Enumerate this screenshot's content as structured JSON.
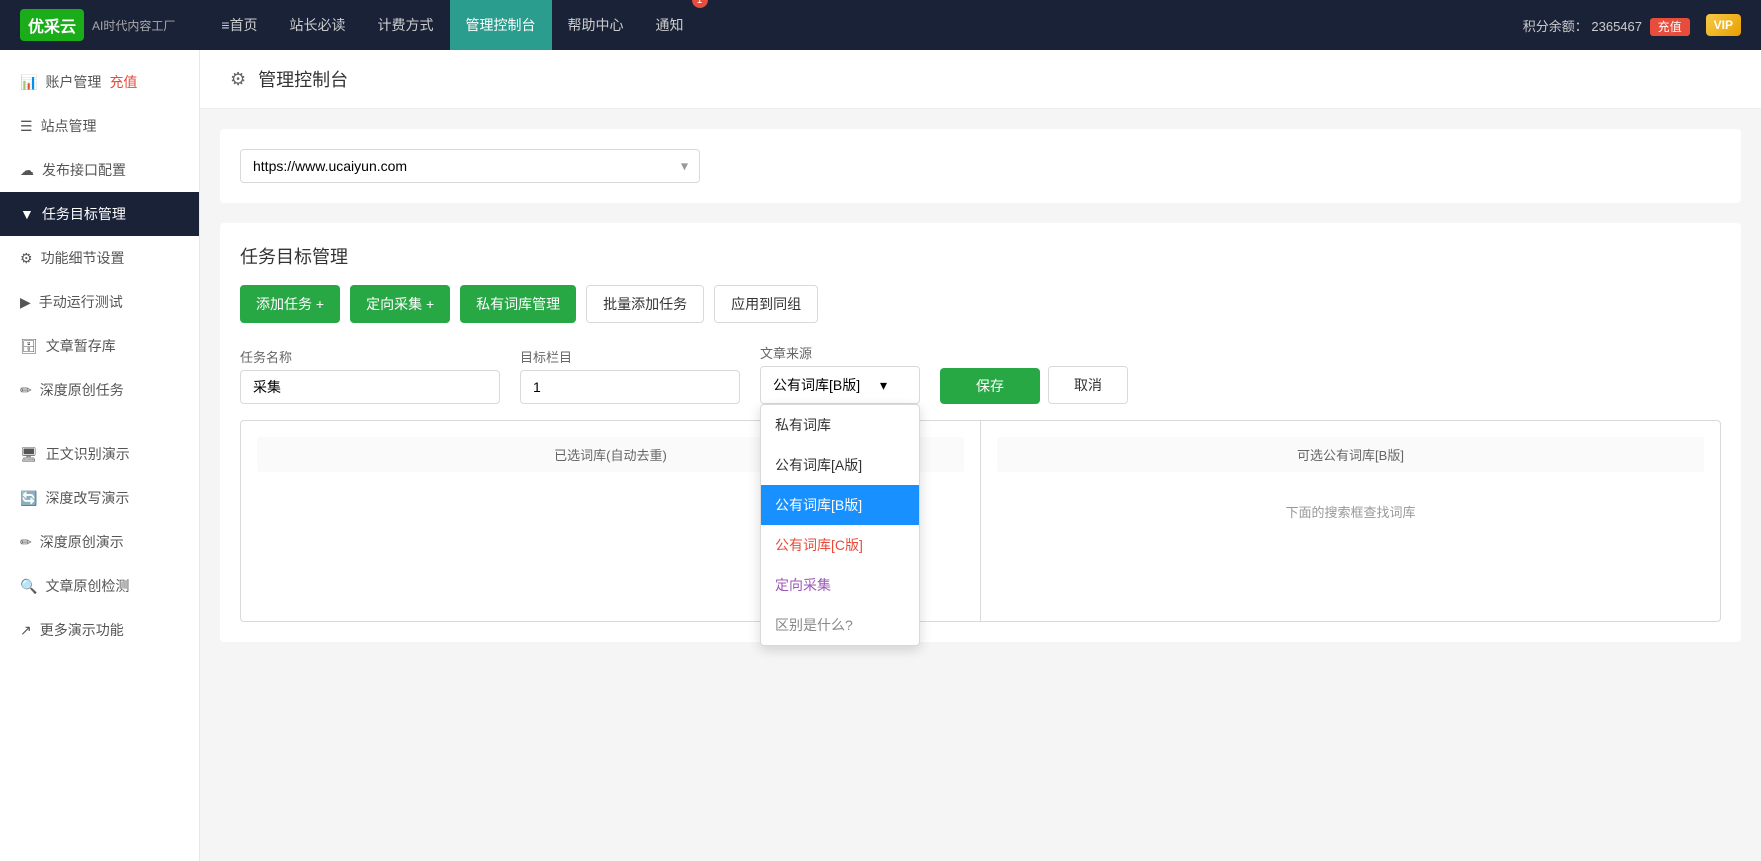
{
  "brand": {
    "logo": "优采云",
    "subtitle": "AI时代内容工厂"
  },
  "topnav": {
    "items": [
      {
        "id": "home",
        "label": "首页",
        "icon": "≡",
        "active": false
      },
      {
        "id": "webmaster",
        "label": "站长必读",
        "active": false
      },
      {
        "id": "pricing",
        "label": "计费方式",
        "active": false
      },
      {
        "id": "dashboard",
        "label": "管理控制台",
        "active": true
      },
      {
        "id": "help",
        "label": "帮助中心",
        "active": false
      },
      {
        "id": "notification",
        "label": "通知",
        "badge": "1",
        "active": false
      }
    ],
    "points_label": "积分余额：",
    "points_value": "2365467",
    "recharge_label": "充值",
    "vip_label": "VIP"
  },
  "sidebar": {
    "items": [
      {
        "id": "account",
        "label": "账户管理",
        "icon": "📊",
        "recharge": true
      },
      {
        "id": "sites",
        "label": "站点管理",
        "icon": "☰"
      },
      {
        "id": "publish",
        "label": "发布接口配置",
        "icon": "☁"
      },
      {
        "id": "task",
        "label": "任务目标管理",
        "icon": "▼",
        "active": true
      },
      {
        "id": "features",
        "label": "功能细节设置",
        "icon": "⚙"
      },
      {
        "id": "manual",
        "label": "手动运行测试",
        "icon": "▶"
      },
      {
        "id": "drafts",
        "label": "文章暂存库",
        "icon": "🗄"
      },
      {
        "id": "deep",
        "label": "深度原创任务",
        "icon": "✏"
      }
    ],
    "demo_items": [
      {
        "id": "ocr",
        "label": "正文识别演示",
        "icon": "🖥"
      },
      {
        "id": "rewrite",
        "label": "深度改写演示",
        "icon": "🔄"
      },
      {
        "id": "original",
        "label": "深度原创演示",
        "icon": "✏"
      },
      {
        "id": "detect",
        "label": "文章原创检测",
        "icon": "🔍"
      },
      {
        "id": "more",
        "label": "更多演示功能",
        "icon": "↗"
      }
    ]
  },
  "page": {
    "title": "管理控制台",
    "settings_icon": "⚙"
  },
  "url_selector": {
    "value": "https://www.ucaiyun.com",
    "options": [
      "https://www.ucaiyun.com"
    ]
  },
  "section_title": "任务目标管理",
  "buttons": {
    "add_task": "添加任务 +",
    "directed_collect": "定向采集 +",
    "private_library": "私有词库管理",
    "batch_add": "批量添加任务",
    "apply_group": "应用到同组",
    "save": "保存",
    "cancel": "取消"
  },
  "form": {
    "task_name_label": "任务名称",
    "task_name_value": "采集",
    "target_column_label": "目标栏目",
    "target_column_value": "1",
    "source_label": "文章来源",
    "source_selected": "公有词库[B版]"
  },
  "source_dropdown": {
    "options": [
      {
        "id": "private",
        "label": "私有词库",
        "color": "default",
        "selected": false
      },
      {
        "id": "public_a",
        "label": "公有词库[A版]",
        "color": "default",
        "selected": false
      },
      {
        "id": "public_b",
        "label": "公有词库[B版]",
        "color": "blue",
        "selected": true
      },
      {
        "id": "public_c",
        "label": "公有词库[C版]",
        "color": "red",
        "selected": false
      },
      {
        "id": "directed",
        "label": "定向采集",
        "color": "purple",
        "selected": false
      },
      {
        "id": "diff",
        "label": "区别是什么?",
        "color": "gray",
        "selected": false
      }
    ]
  },
  "panels": {
    "left_header": "已选词库(自动去重)",
    "right_header": "可选公有词库[B版]",
    "right_hint": "下面的搜索框查找词库"
  }
}
